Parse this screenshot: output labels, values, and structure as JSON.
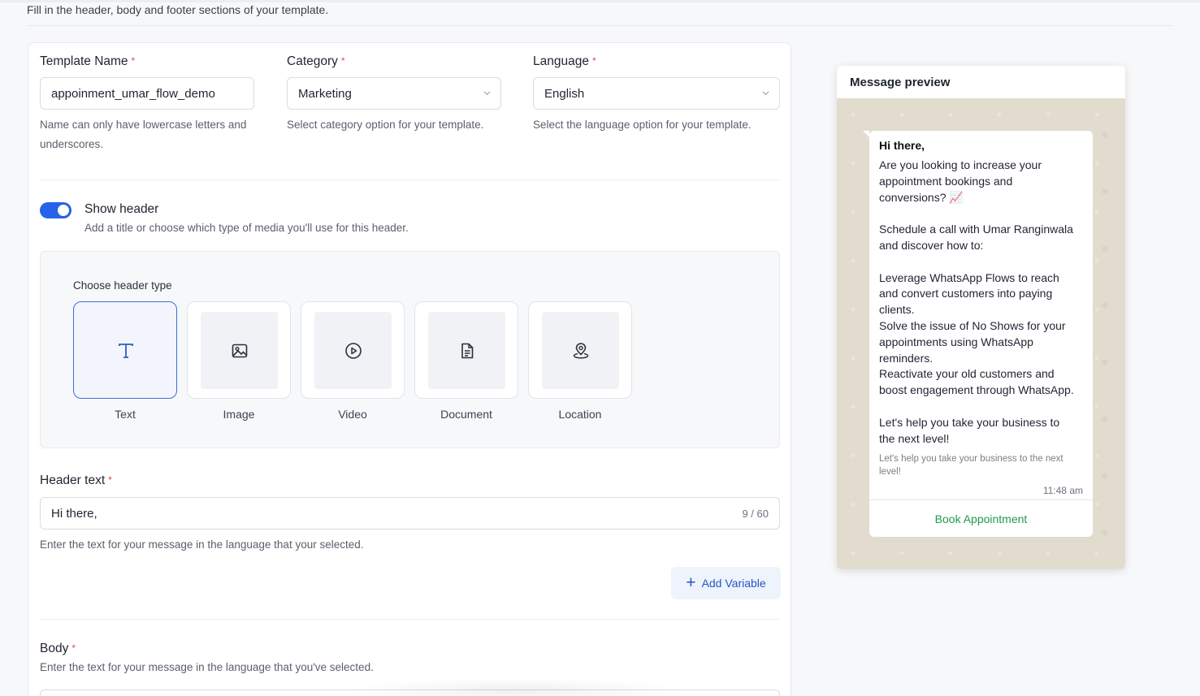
{
  "page": {
    "subtitle": "Fill in the header, body and footer sections of your template."
  },
  "form": {
    "template_name": {
      "label": "Template Name",
      "required_mark": "*",
      "value": "appoinment_umar_flow_demo",
      "help": "Name can only have lowercase letters and underscores."
    },
    "category": {
      "label": "Category",
      "required_mark": "*",
      "value": "Marketing",
      "help": "Select category option for your template."
    },
    "language": {
      "label": "Language",
      "required_mark": "*",
      "value": "English",
      "help": "Select the language option for your template."
    },
    "show_header": {
      "label": "Show header",
      "enabled": true,
      "description": "Add a title or choose which type of media you'll use for this header."
    },
    "header_type": {
      "label": "Choose header type",
      "selected": "Text",
      "options": [
        {
          "label": "Text",
          "icon": "text-icon"
        },
        {
          "label": "Image",
          "icon": "image-icon"
        },
        {
          "label": "Video",
          "icon": "play-circle-icon"
        },
        {
          "label": "Document",
          "icon": "document-icon"
        },
        {
          "label": "Location",
          "icon": "map-pin-icon"
        }
      ]
    },
    "header_text": {
      "label": "Header text",
      "required_mark": "*",
      "value": "Hi there,",
      "counter": "9 / 60",
      "help": "Enter the text for your message in the language that your selected."
    },
    "add_variable": {
      "icon": "+",
      "label": "Add Variable"
    },
    "body": {
      "label": "Body",
      "required_mark": "*",
      "help": "Enter the text for your message in the language that you've selected."
    }
  },
  "preview": {
    "title": "Message preview",
    "header": "Hi there,",
    "body_lines": [
      "Are you looking to increase your",
      "appointment bookings and",
      "conversions? 📈",
      "",
      "Schedule a call with Umar Ranginwala",
      "and discover how to:",
      "",
      "Leverage WhatsApp Flows to reach",
      "and convert customers into paying",
      "clients.",
      "Solve the issue of No Shows for your",
      "appointments using WhatsApp",
      "reminders.",
      "Reactivate your old customers and",
      "boost engagement through WhatsApp.",
      "",
      "Let's help you take your business to",
      "the next level!"
    ],
    "footer_lines": [
      "Let's help you take your business to the next",
      "level!"
    ],
    "time": "11:48 am",
    "button_label": "Book Appointment"
  },
  "colors": {
    "accent": "#2563eb",
    "required": "#e54848",
    "cta_green": "#1f9b4e",
    "chat_bg": "#e2dccf"
  }
}
